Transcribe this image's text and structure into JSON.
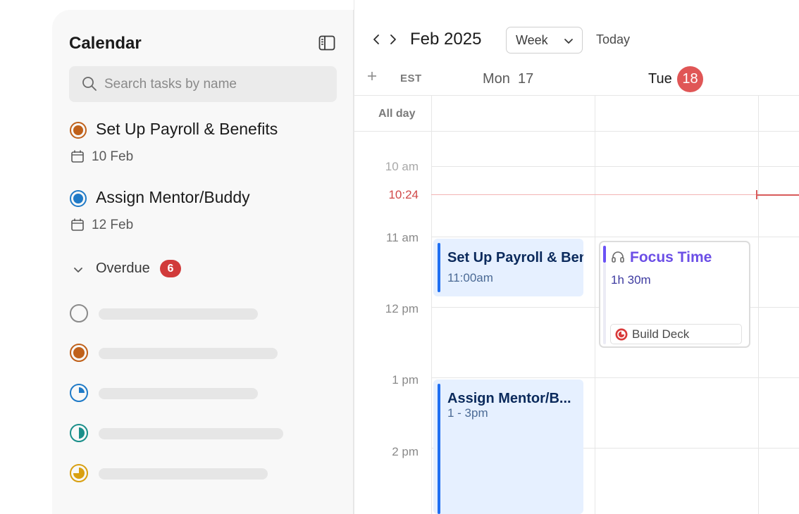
{
  "sidebar": {
    "title": "Calendar",
    "search_placeholder": "Search tasks by name",
    "tasks": [
      {
        "name": "Set Up Payroll & Benefits",
        "date": "10 Feb",
        "color": "#c0611a"
      },
      {
        "name": "Assign Mentor/Buddy",
        "date": "12 Feb",
        "color": "#1f7ac7"
      }
    ],
    "overdue": {
      "label": "Overdue",
      "count": "6"
    },
    "skeleton_colors": [
      "#8a8a8a",
      "#c0611a",
      "#1f7ac7",
      "#1a8f8a",
      "#d9a012"
    ]
  },
  "header": {
    "month": "Feb 2025",
    "view": "Week",
    "today": "Today",
    "timezone": "EST",
    "days": [
      {
        "name": "Mon",
        "num": "17"
      },
      {
        "name": "Tue",
        "num": "18"
      }
    ]
  },
  "grid": {
    "allday": "All day",
    "times": [
      "10 am",
      "11 am",
      "12 pm",
      "1 pm",
      "2 pm"
    ],
    "now": "10:24"
  },
  "events": {
    "payroll": {
      "title": "Set Up Payroll & Benefits",
      "time": "11:00am"
    },
    "mentor": {
      "title": "Assign Mentor/B...",
      "time": "1 - 3pm"
    },
    "focus": {
      "title": "Focus Time",
      "duration": "1h 30m",
      "task": "Build Deck"
    }
  },
  "colors": {
    "accent": "#1f6ff2",
    "today": "#e05656",
    "now": "#d14848",
    "focus": "#6b4ee6"
  }
}
